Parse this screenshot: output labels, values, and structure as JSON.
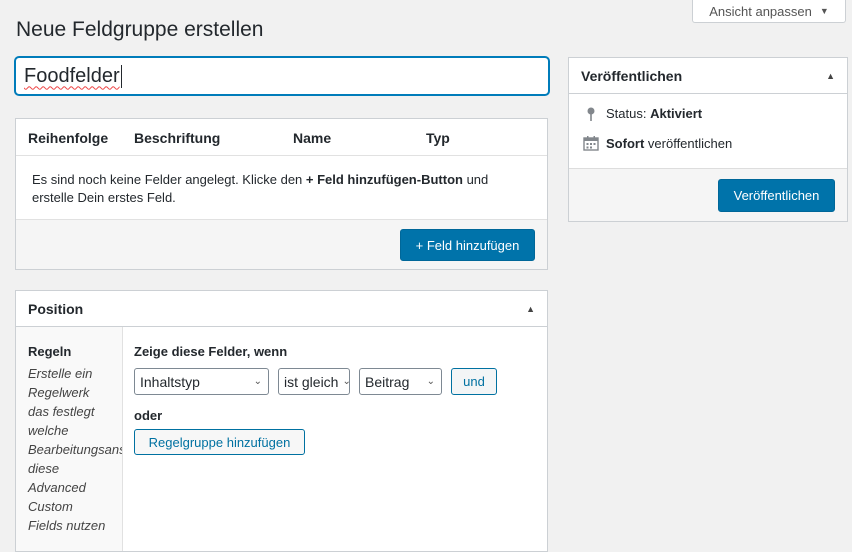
{
  "screen_options": {
    "label": "Ansicht anpassen"
  },
  "page": {
    "title": "Neue Feldgruppe erstellen"
  },
  "title_input": {
    "value": "Foodfelder"
  },
  "fields": {
    "columns": [
      "Reihenfolge",
      "Beschriftung",
      "Name",
      "Typ"
    ],
    "empty_text_1": "Es sind noch keine Felder angelegt. Klicke den ",
    "empty_text_bold": "+ Feld hinzufügen-Button",
    "empty_text_2": " und erstelle Dein erstes Feld.",
    "add_button": "+ Feld hinzufügen"
  },
  "position": {
    "title": "Position",
    "rules_label": "Regeln",
    "rules_desc": [
      "Erstelle ein",
      "Regelwerk",
      "das festlegt",
      "welche",
      "Bearbeitungsansichten",
      "diese",
      "Advanced",
      "Custom",
      "Fields nutzen"
    ],
    "rules_title": "Zeige diese Felder, wenn",
    "rule": {
      "param": "Inhaltstyp",
      "operator": "ist gleich",
      "value": "Beitrag",
      "and_label": "und"
    },
    "or_label": "oder",
    "add_group_button": "Regelgruppe hinzufügen"
  },
  "publish": {
    "title": "Veröffentlichen",
    "status_label": "Status:",
    "status_value": "Aktiviert",
    "schedule_bold": "Sofort",
    "schedule_text": "veröffentlichen",
    "button": "Veröffentlichen"
  },
  "icons": {
    "pin": "pin-icon",
    "calendar": "calendar-icon",
    "arrow_up": "arrow-up-icon",
    "chevron_down": "chevron-down-icon"
  }
}
